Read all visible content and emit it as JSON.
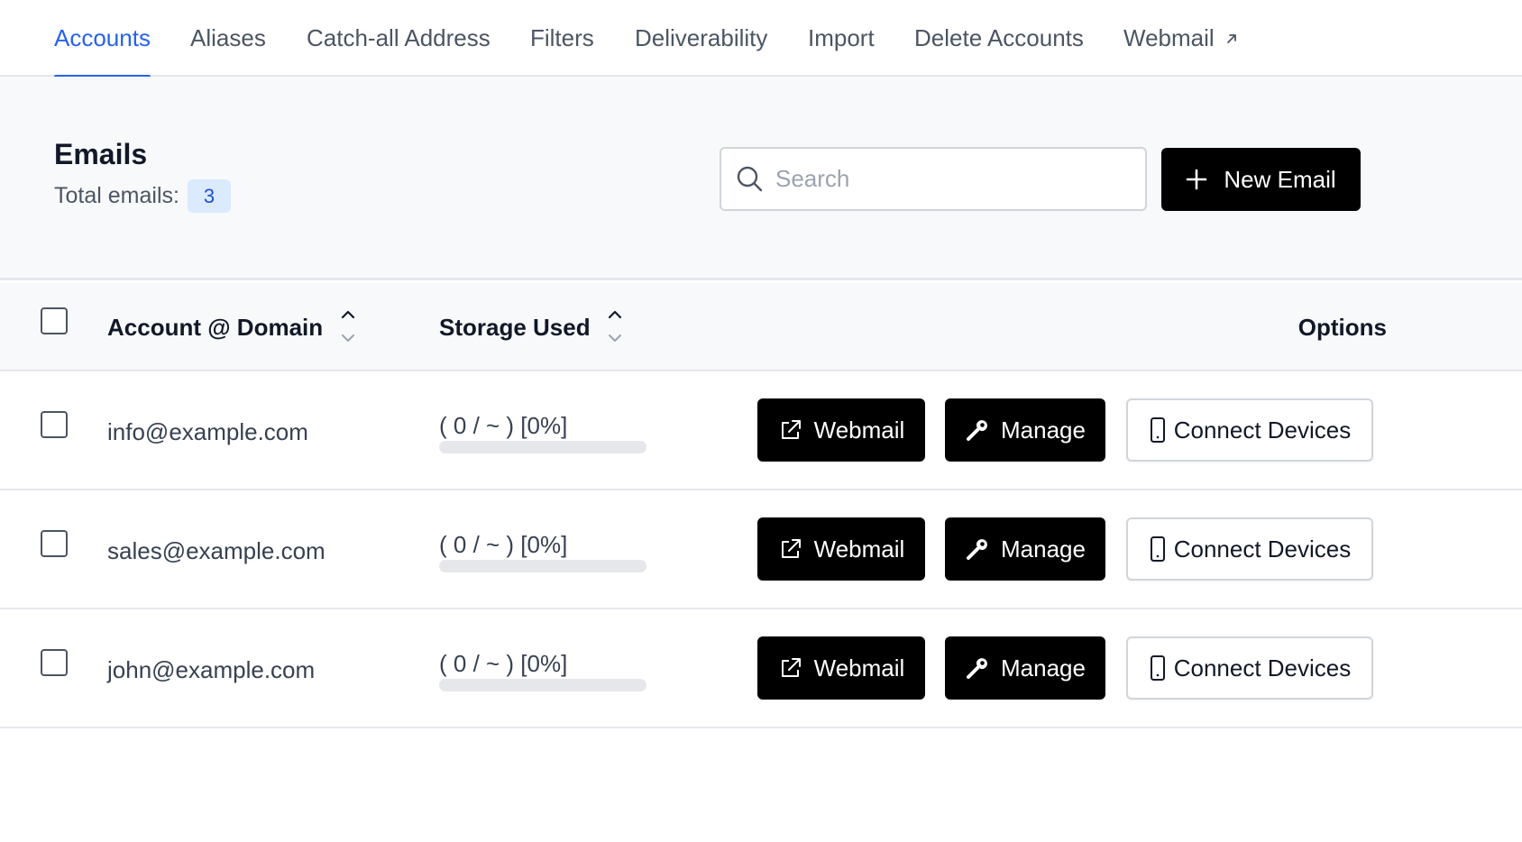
{
  "tabs": [
    {
      "label": "Accounts",
      "active": true
    },
    {
      "label": "Aliases",
      "active": false
    },
    {
      "label": "Catch-all Address",
      "active": false
    },
    {
      "label": "Filters",
      "active": false
    },
    {
      "label": "Deliverability",
      "active": false
    },
    {
      "label": "Import",
      "active": false
    },
    {
      "label": "Delete Accounts",
      "active": false
    },
    {
      "label": "Webmail",
      "active": false,
      "icon": "external-arrow-icon"
    }
  ],
  "header": {
    "title": "Emails",
    "total_label": "Total emails:",
    "total_count": "3"
  },
  "search": {
    "placeholder": "Search",
    "value": "",
    "icon": "search-icon"
  },
  "new_email_button": {
    "label": "New Email",
    "icon": "plus-icon"
  },
  "table": {
    "columns": {
      "account": "Account @ Domain",
      "storage": "Storage Used",
      "options": "Options"
    },
    "rows": [
      {
        "email": "info@example.com",
        "storage": "( 0 / ~ ) [0%]",
        "storage_percent": 0
      },
      {
        "email": "sales@example.com",
        "storage": "( 0 / ~ ) [0%]",
        "storage_percent": 0
      },
      {
        "email": "john@example.com",
        "storage": "( 0 / ~ ) [0%]",
        "storage_percent": 0
      }
    ],
    "actions": {
      "webmail": "Webmail",
      "manage": "Manage",
      "connect": "Connect Devices"
    }
  },
  "colors": {
    "accent": "#2563eb",
    "primary_button": "#000000",
    "header_background": "#f8f9fb",
    "badge_background": "#dbeafe"
  }
}
